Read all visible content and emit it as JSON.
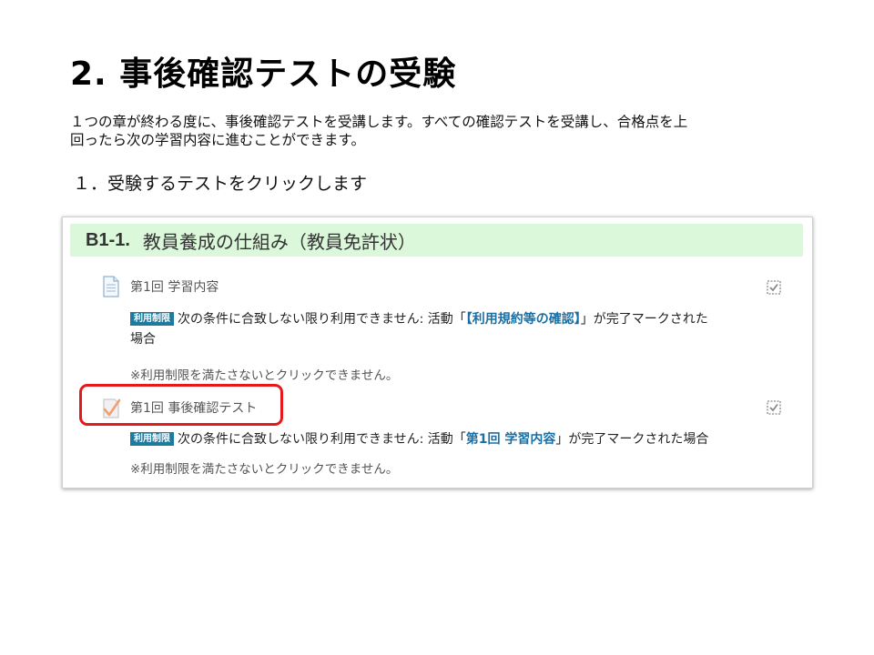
{
  "slide": {
    "title": "2. 事後確認テストの受験",
    "intro_line1": "１つの章が終わる度に、事後確認テストを受講します。すべての確認テストを受講し、合格点を上",
    "intro_line2": "回ったら次の学習内容に進むことができます。",
    "step": "１．受験するテストをクリックします"
  },
  "course": {
    "section_code": "B1-1.",
    "section_name": "教員養成の仕組み（教員免許状）",
    "activities": [
      {
        "title": "第1回 学習内容",
        "icon": "page-icon",
        "badge": "利用制限",
        "restriction_prefix": "次の条件に合致しない限り利用できません: 活動「",
        "restriction_link": "【利用規約等の確認】",
        "restriction_suffix": "」が完了マークされた",
        "restriction_wrap": "場合",
        "note": "※利用制限を満たさないとクリックできません。"
      },
      {
        "title": "第1回 事後確認テスト",
        "icon": "quiz-icon",
        "badge": "利用制限",
        "restriction_prefix": "次の条件に合致しない限り利用できません: 活動「",
        "restriction_link": "第1回 学習内容",
        "restriction_suffix": "」が完了マークされた場合",
        "note": "※利用制限を満たさないとクリックできません。"
      }
    ]
  },
  "colors": {
    "section_bg": "#dcf8da",
    "badge_bg": "#1f7b9e",
    "link": "#1a6fa5",
    "highlight": "#e5191c"
  }
}
